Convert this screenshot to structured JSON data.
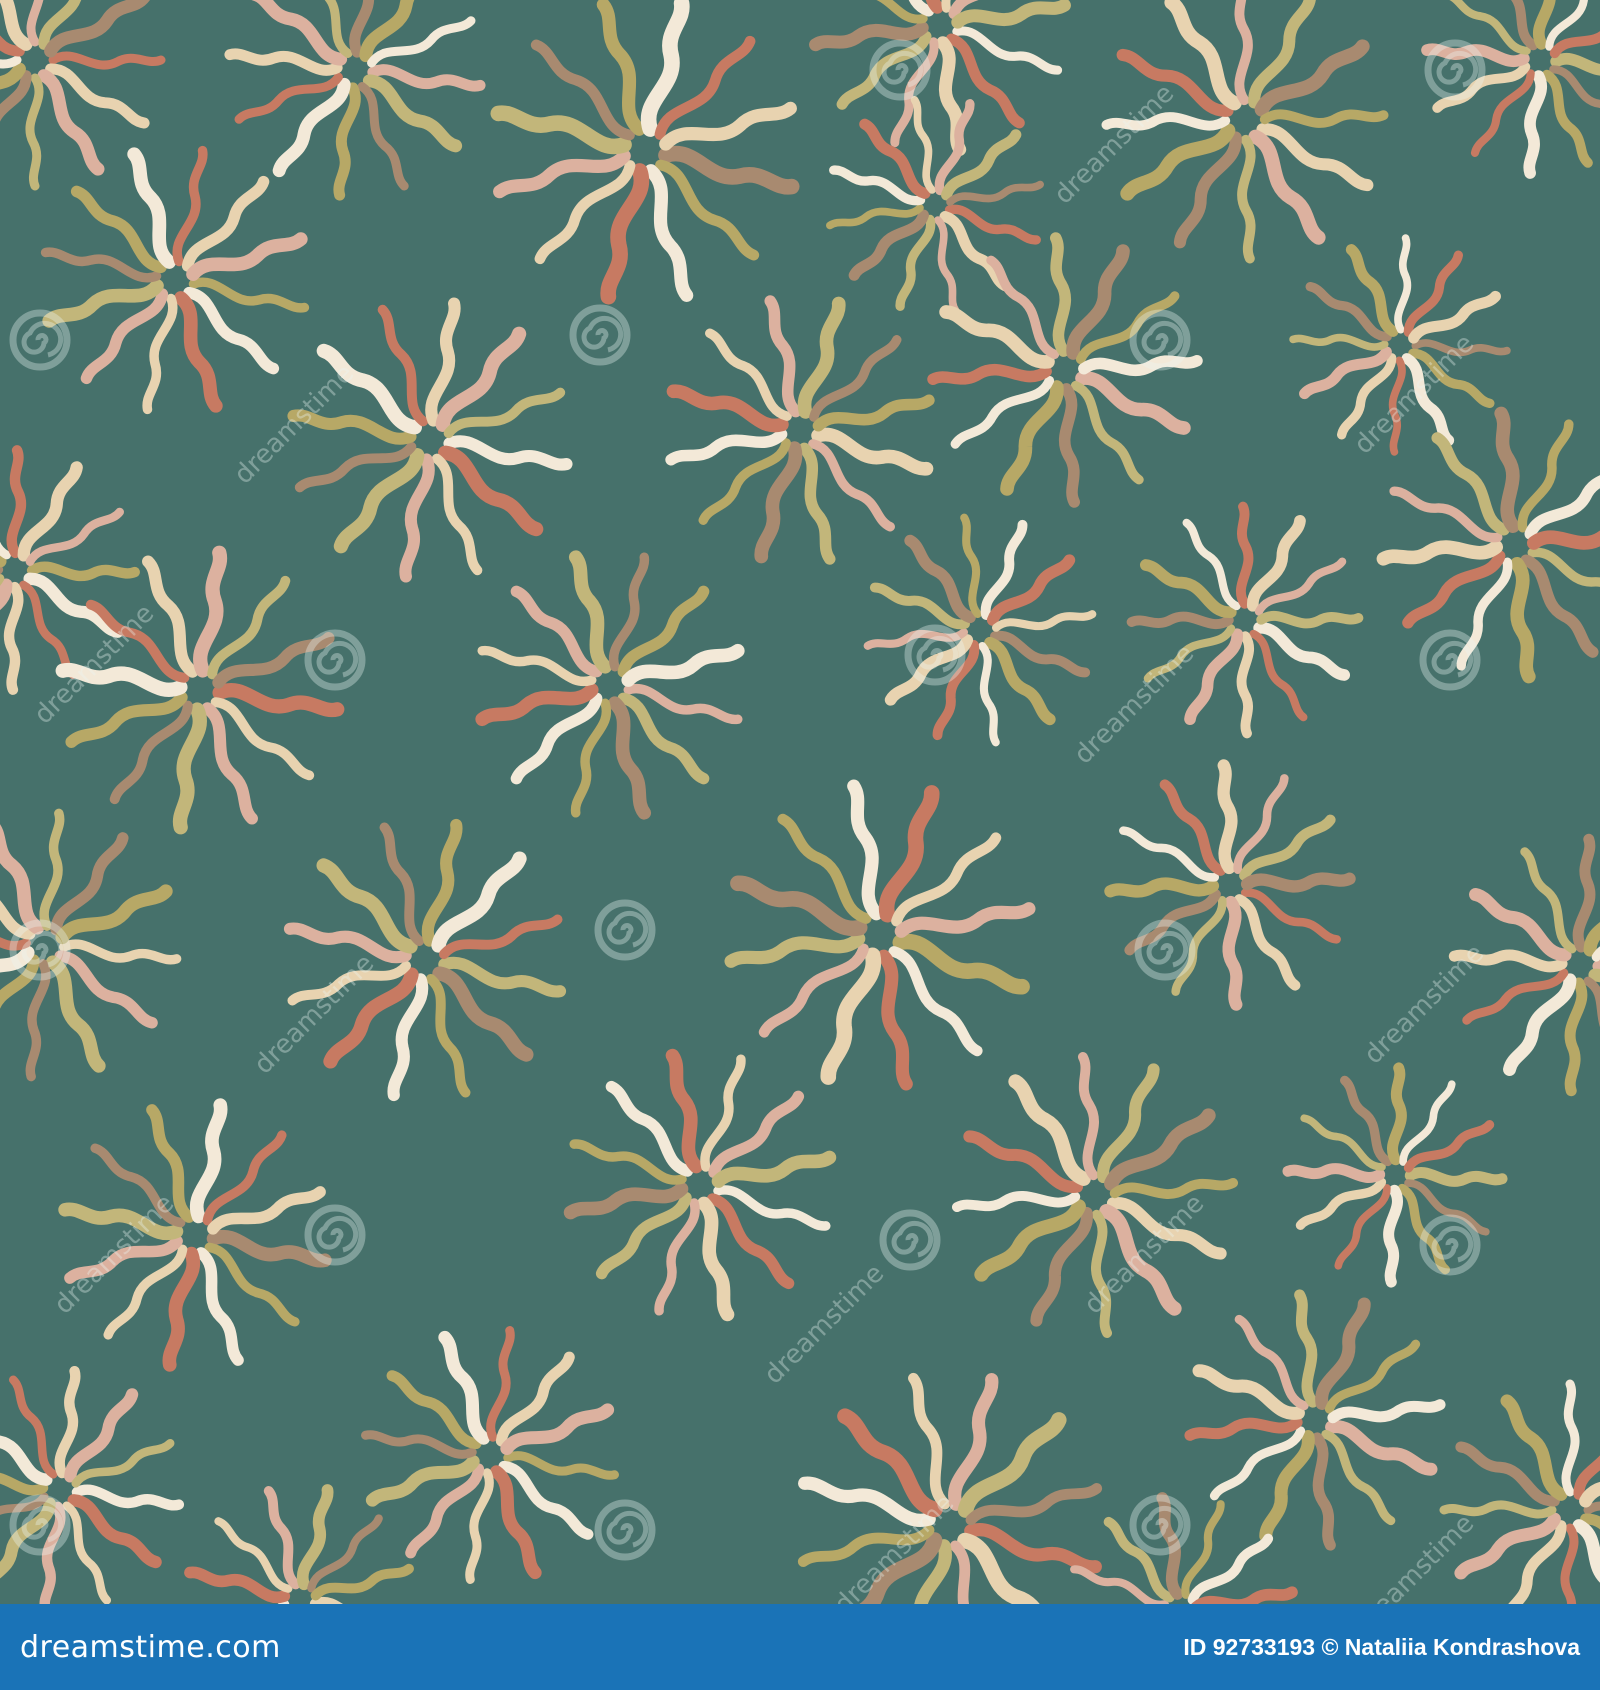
{
  "colors": {
    "background": "#46716b",
    "footer_bar": "#1a73b7",
    "footer_text": "#ffffff",
    "palette": [
      "#c77a62",
      "#c2b67a",
      "#f3e9d8",
      "#dcb19f",
      "#b7a866",
      "#e8d3b0",
      "#a88a70"
    ],
    "watermark": "rgba(235,245,243,0.35)"
  },
  "pattern": {
    "motif": "swirling sun flowers (wavy petal strokes radiating from a center)",
    "petal_count": 12
  },
  "watermark": {
    "text": "dreamstime",
    "icon": "dreamstime-spiral-logo"
  },
  "footer": {
    "site": "dreamstime.com",
    "credit": "ID 92733193 © Nataliia Kondrashova"
  }
}
